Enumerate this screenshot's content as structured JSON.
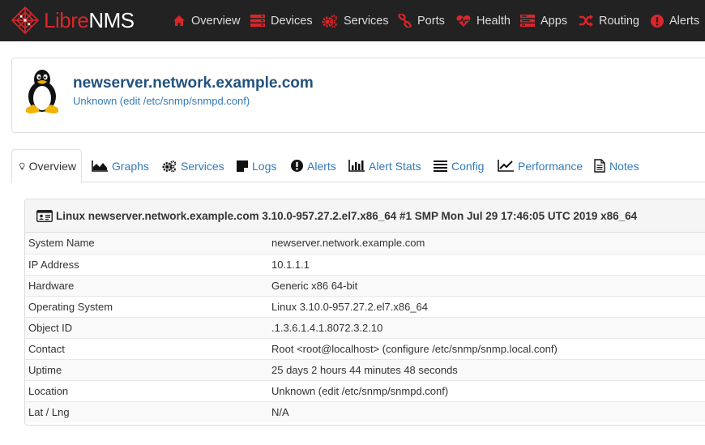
{
  "navbar": {
    "brand_libre": "Libre",
    "brand_nms": "NMS",
    "items": [
      {
        "label": "Overview",
        "icon": "home-icon"
      },
      {
        "label": "Devices",
        "icon": "server-icon"
      },
      {
        "label": "Services",
        "icon": "cogs-icon"
      },
      {
        "label": "Ports",
        "icon": "link-icon"
      },
      {
        "label": "Health",
        "icon": "heartbeat-icon"
      },
      {
        "label": "Apps",
        "icon": "tasks-icon"
      },
      {
        "label": "Routing",
        "icon": "random-icon"
      },
      {
        "label": "Alerts",
        "icon": "exclamation-circle-icon"
      }
    ],
    "accent": "#d9262a"
  },
  "device": {
    "hostname": "newserver.network.example.com",
    "location": "Unknown (edit /etc/snmp/snmpd.conf)",
    "os_icon": "linux-tux-icon"
  },
  "tabs": [
    {
      "label": "Overview",
      "icon": "lightbulb-icon",
      "active": true
    },
    {
      "label": "Graphs",
      "icon": "area-chart-icon"
    },
    {
      "label": "Services",
      "icon": "cogs-icon"
    },
    {
      "label": "Logs",
      "icon": "sticky-note-icon"
    },
    {
      "label": "Alerts",
      "icon": "exclamation-circle-icon"
    },
    {
      "label": "Alert Stats",
      "icon": "bar-chart-icon"
    },
    {
      "label": "Config",
      "icon": "align-justify-icon"
    },
    {
      "label": "Performance",
      "icon": "line-chart-icon"
    },
    {
      "label": "Notes",
      "icon": "file-text-icon"
    }
  ],
  "overview": {
    "heading": "Linux newserver.network.example.com 3.10.0-957.27.2.el7.x86_64 #1 SMP Mon Jul 29 17:46:05 UTC 2019 x86_64",
    "heading_icon": "id-card-icon",
    "rows": [
      {
        "key": "System Name",
        "value": "newserver.network.example.com"
      },
      {
        "key": "IP Address",
        "value": "10.1.1.1"
      },
      {
        "key": "Hardware",
        "value": "Generic x86 64-bit"
      },
      {
        "key": "Operating System",
        "value": "Linux 3.10.0-957.27.2.el7.x86_64"
      },
      {
        "key": "Object ID",
        "value": ".1.3.6.1.4.1.8072.3.2.10"
      },
      {
        "key": "Contact",
        "value": "Root <root@localhost> (configure /etc/snmp/snmp.local.conf)"
      },
      {
        "key": "Uptime",
        "value": "25 days 2 hours 44 minutes 48 seconds"
      },
      {
        "key": "Location",
        "value": "Unknown (edit /etc/snmp/snmpd.conf)"
      },
      {
        "key": "Lat / Lng",
        "value": "N/A"
      }
    ]
  }
}
